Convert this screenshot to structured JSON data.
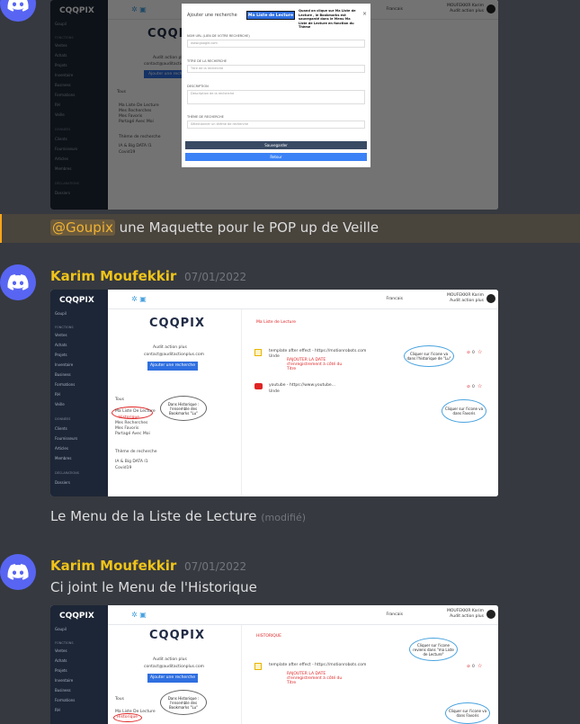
{
  "messages": {
    "first": {
      "mention": "@Goupix",
      "text": " une Maquette pour le POP up de Veille"
    },
    "second": {
      "author": "Karim Moufekkir",
      "timestamp": "07/01/2022",
      "text": "Le Menu de la Liste de Lecture",
      "edited": "(modifié)"
    },
    "third": {
      "author": "Karim Moufekkir",
      "timestamp": "07/01/2022",
      "text": "Ci joint le Menu de l'Historique"
    }
  },
  "app": {
    "logo": "CQQPIX",
    "brand": "CQQPIX",
    "org": "Goupil",
    "lang": "Francais",
    "user_name": "MOUFEKKIR Karim",
    "user_sub": "Audit action plus",
    "sidebar_sec1": "FONCTIONS",
    "sidebar_items": [
      "Ventes",
      "Achats",
      "Projets",
      "Inventaire",
      "Business",
      "Formations",
      "RH",
      "Veille"
    ],
    "sidebar_sec2": "DONNÉES",
    "sidebar_items2": [
      "Clients",
      "Fournisseurs",
      "Articles",
      "Membres"
    ],
    "sidebar_sec3": "DÉCLARATIONS",
    "sidebar_items3": [
      "Dossiers"
    ],
    "profile_name": "Audit action plus",
    "profile_email": "contact@auditactionplus.com",
    "add_search": "Ajouter une recherche",
    "tous": "Tous",
    "menu_reading": "Ma Liste De Lecture",
    "menu_history": "Historique",
    "menu_searches": "Mes Recherches",
    "menu_favorites": "Mes Favoris",
    "menu_shared": "Partagé Avec Moi",
    "theme_label": "Thème de recherche",
    "theme1": "IA & Big DATA I1",
    "theme2": "Covid19",
    "reading_title": "Ma Liste de Lecture",
    "history_title": "HISTORIQUE",
    "item1_src": "template after effect - https://motionrobots.com",
    "item1_sub": "Unde",
    "item1_note": "RAJOUTER LA DATE d'enregistrement à côté du Titre",
    "item2_src": "youtube - https://www.youtube...",
    "item2_sub": "Unde",
    "count": "0",
    "bubble_history": "Dans Historique : l'ensemble des Bookmarks \"Lu\"",
    "bubble_click_icon": "Cliquer sur l'icone va dans l'historique de \"Lu\"",
    "bubble_favoris": "Cliquer sur l'icone va dans Favoris",
    "bubble_reading_return": "Cliquer sur l'icone reviens dans \"ma Liste de Lecture\""
  },
  "modal": {
    "title": "Ajouter une recherche",
    "badge": "Ma Liste de Lecture",
    "badge_note": "Quand on clique sur Ma Liste de Lecture , le Bookmarks est sauvegardé dans le Menu Ma Liste de Lecture en fonction du Thème",
    "label_url": "NOM URL (LIEN DE VOTRE RECHERCHE)",
    "ph_url": "www.google.com",
    "label_title": "TITRE DE LA RECHERCHE",
    "ph_title": "Titre de la recherche",
    "label_desc": "DESCRIPTION",
    "ph_desc": "Description de la recherche",
    "label_theme": "THÈME DE RECHERCHE",
    "ph_theme": "Sélectionner un thème de recherche",
    "save": "Sauvegarder",
    "back": "Retour"
  }
}
